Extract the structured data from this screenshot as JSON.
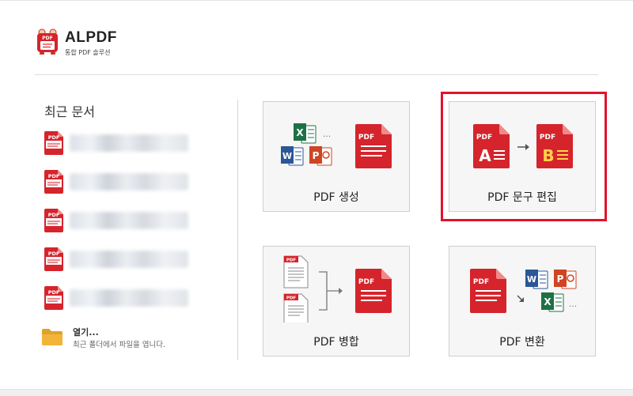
{
  "app": {
    "name": "ALPDF",
    "subtitle": "통합 PDF 솔루션",
    "logo_text": "PDF"
  },
  "recent": {
    "title": "최근 문서",
    "file_icon_text": "PDF",
    "item_count": 5
  },
  "open": {
    "title": "열기...",
    "description": "최근 폴더에서 파일을 엽니다."
  },
  "tiles": {
    "create": {
      "label": "PDF 생성"
    },
    "edit": {
      "label": "PDF 문구 편집"
    },
    "merge": {
      "label": "PDF 병합"
    },
    "convert": {
      "label": "PDF 변환"
    }
  },
  "icons": {
    "pdf_text": "PDF",
    "excel_letter": "X",
    "word_letter": "W",
    "ppt_letter": "P",
    "edit_before": "A",
    "edit_after": "B",
    "ellipsis": "..."
  },
  "colors": {
    "pdf_red": "#d5242c",
    "highlight_red": "#e3112b",
    "excel_green": "#1e7145",
    "word_blue": "#2b5797",
    "ppt_orange": "#d04423",
    "folder_yellow": "#f2b53a",
    "edit_yellow": "#ffd24a"
  }
}
